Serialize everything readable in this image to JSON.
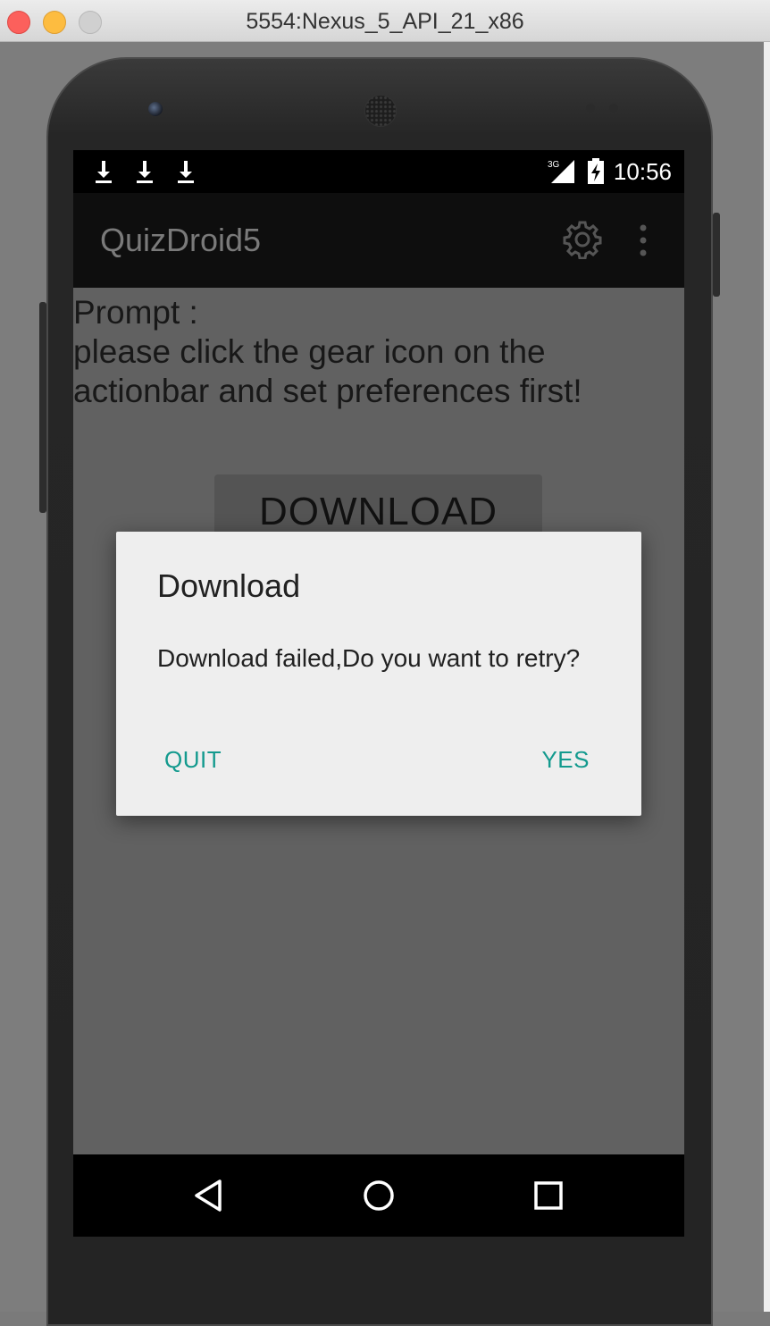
{
  "window": {
    "title": "5554:Nexus_5_API_21_x86"
  },
  "statusbar": {
    "download_icons": [
      "download-icon",
      "download-icon",
      "download-icon"
    ],
    "network": "3G",
    "time": "10:56"
  },
  "actionbar": {
    "app_title": "QuizDroid5",
    "settings_icon": "gear-icon",
    "overflow_icon": "overflow-menu-icon"
  },
  "main": {
    "prompt_label": "Prompt :",
    "prompt_line1": "please click the gear icon on the",
    "prompt_line2": "actionbar and set preferences first!",
    "download_button": "DOWNLOAD"
  },
  "dialog": {
    "title": "Download",
    "message": "Download failed,Do you want to retry?",
    "negative_button": "QUIT",
    "positive_button": "YES",
    "accent_color": "#139a8e"
  },
  "navbar": {
    "back_icon": "back-triangle-icon",
    "home_icon": "home-circle-icon",
    "recents_icon": "recents-square-icon"
  }
}
